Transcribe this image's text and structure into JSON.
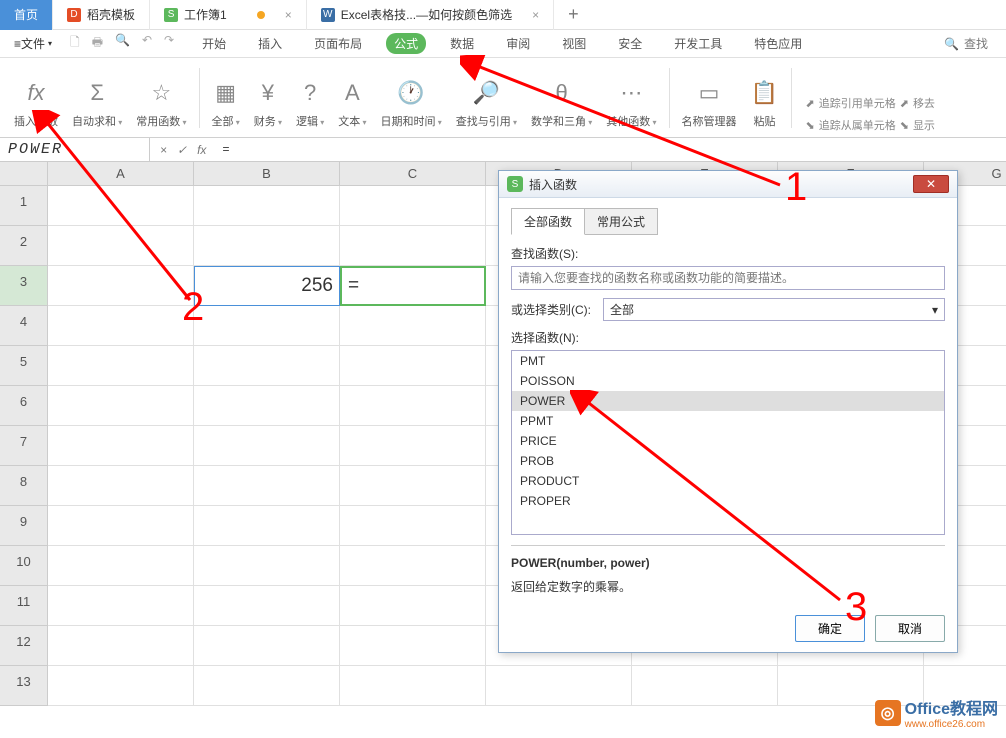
{
  "tabs": {
    "home": "首页",
    "docer": "稻壳模板",
    "workbook": "工作簿1",
    "excel_tip": "Excel表格技...—如何按颜色筛选"
  },
  "file_label": "文件",
  "menu": {
    "start": "开始",
    "insert": "插入",
    "page": "页面布局",
    "formula": "公式",
    "data": "数据",
    "review": "审阅",
    "view": "视图",
    "security": "安全",
    "dev": "开发工具",
    "special": "特色应用",
    "search": "查找"
  },
  "ribbon": {
    "insert_fn": "插入函数",
    "autosum": "自动求和",
    "common": "常用函数",
    "all": "全部",
    "finance": "财务",
    "logic": "逻辑",
    "text": "文本",
    "datetime": "日期和时间",
    "lookup": "查找与引用",
    "math": "数学和三角",
    "other": "其他函数",
    "name_mgr": "名称管理器",
    "paste": "粘贴",
    "trace_ref": "追踪引用单元格",
    "trace_dep": "追踪从属单元格",
    "remove": "移去",
    "show": "显示"
  },
  "name_box": "POWER",
  "formula_input": "=",
  "columns": [
    "A",
    "B",
    "C",
    "D",
    "E",
    "F",
    "G"
  ],
  "rows": [
    "1",
    "2",
    "3",
    "4",
    "5",
    "6",
    "7",
    "8",
    "9",
    "10",
    "11",
    "12",
    "13"
  ],
  "cell_b3": "256",
  "cell_c3": "=",
  "dialog": {
    "title": "插入函数",
    "tab_all": "全部函数",
    "tab_common": "常用公式",
    "search_label": "查找函数(S):",
    "search_placeholder": "请输入您要查找的函数名称或函数功能的简要描述。",
    "category_label": "或选择类别(C):",
    "category_value": "全部",
    "select_label": "选择函数(N):",
    "functions": [
      "PMT",
      "POISSON",
      "POWER",
      "PPMT",
      "PRICE",
      "PROB",
      "PRODUCT",
      "PROPER"
    ],
    "selected_fn": "POWER",
    "signature": "POWER(number, power)",
    "description": "返回给定数字的乘幂。",
    "ok": "确定",
    "cancel": "取消"
  },
  "annotations": {
    "a1": "1",
    "a2": "2",
    "a3": "3"
  },
  "watermark": {
    "brand1": "Office",
    "brand2": "教程网",
    "url": "www.office26.com"
  }
}
